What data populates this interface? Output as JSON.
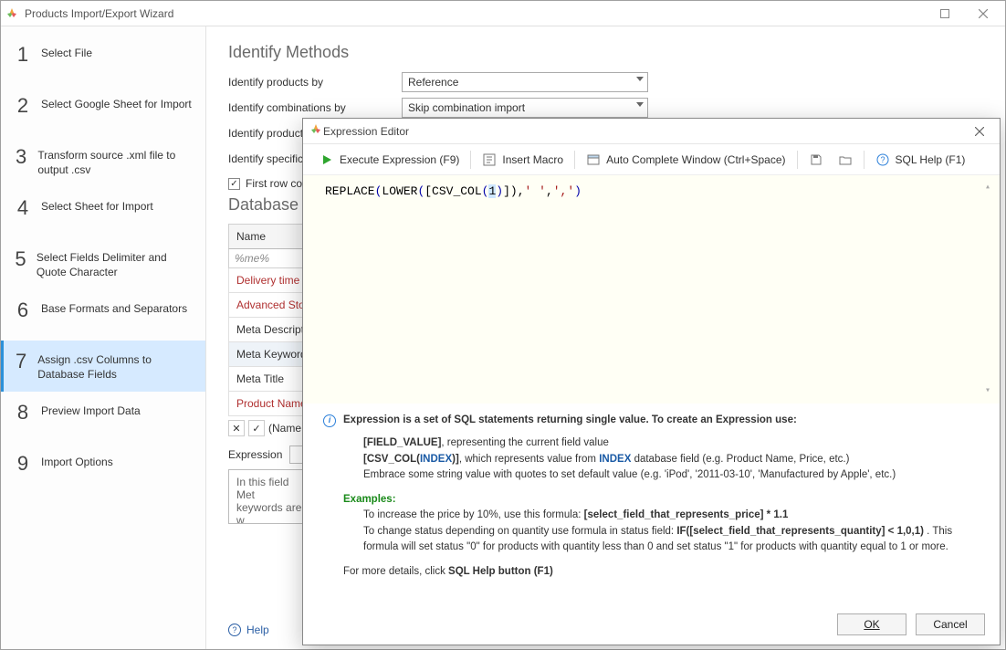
{
  "window": {
    "title": "Products Import/Export Wizard"
  },
  "steps": [
    {
      "num": "1",
      "label": "Select File"
    },
    {
      "num": "2",
      "label": "Select Google Sheet for Import"
    },
    {
      "num": "3",
      "label": "Transform source .xml file to output .csv"
    },
    {
      "num": "4",
      "label": "Select Sheet for Import"
    },
    {
      "num": "5",
      "label": "Select Fields Delimiter and Quote Character"
    },
    {
      "num": "6",
      "label": "Base Formats and Separators"
    },
    {
      "num": "7",
      "label": "Assign .csv Columns to Database Fields"
    },
    {
      "num": "8",
      "label": "Preview Import Data"
    },
    {
      "num": "9",
      "label": "Import Options"
    }
  ],
  "identify": {
    "section_title": "Identify Methods",
    "rows": {
      "products_by_label": "Identify products by",
      "products_by_value": "Reference",
      "combinations_by_label": "Identify combinations by",
      "combinations_by_value": "Skip combination import",
      "products_label_cut": "Identify product",
      "specific_label_cut": "Identify specific"
    },
    "first_row_label_cut": "First row con",
    "db_fields_title_cut": "Database F"
  },
  "table": {
    "header_name": "Name",
    "filter_text": "%me%",
    "rows": [
      {
        "text": "Delivery time",
        "red": true
      },
      {
        "text": "Advanced Stock",
        "red": true
      },
      {
        "text": "Meta Description",
        "red": false
      },
      {
        "text": "Meta Keywords",
        "red": false,
        "selected": true
      },
      {
        "text": "Meta Title",
        "red": false
      },
      {
        "text": "Product Name",
        "red": true
      }
    ],
    "name_cut": "(Name",
    "expression_label": "Expression",
    "desc_cut": "In this field Met keywords are w"
  },
  "help_label": "Help",
  "modal": {
    "title": "Expression Editor",
    "toolbar": {
      "execute": "Execute Expression (F9)",
      "insert_macro": "Insert Macro",
      "autocomplete": "Auto Complete Window (Ctrl+Space)",
      "sql_help": "SQL Help (F1)"
    },
    "expression_parts": {
      "p1": "REPLACE",
      "p2": "(",
      "p3": "LOWER",
      "p4": "(",
      "p5": "[CSV_COL",
      "p6": "(",
      "p7": "1",
      "p8": ")",
      "p9": "])",
      "p10": ",",
      "p11": "' '",
      "p12": ",",
      "p13": "','",
      "p14": ")"
    },
    "info": {
      "lead": "Expression is a set of SQL statements returning single value. To create an Expression use:",
      "fv_bold": "[FIELD_VALUE]",
      "fv_tail": ", representing the current field value",
      "csv_part1": "[CSV_COL(",
      "csv_index": "INDEX",
      "csv_part2": ")]",
      "csv_tail1": ", which represents value from ",
      "csv_tail2": " database field (e.g. Product Name, Price, etc.)",
      "embrace": "Embrace some string value with quotes to set default value (e.g. 'iPod', '2011-03-10', 'Manufactured by Apple', etc.)",
      "examples_label": "Examples:",
      "ex1_a": "To increase the price by 10%, use this formula: ",
      "ex1_b": "[select_field_that_represents_price] * 1.1",
      "ex2_a": "To change status depending on quantity use formula in status field: ",
      "ex2_b": "IF([select_field_that_represents_quantity] < 1,0,1)",
      "ex2_tail": " . This formula will set status \"0\" for products with quantity less than 0 and set status \"1\" for products with quantity equal to 1 or more.",
      "details_a": "For more details, click ",
      "details_b": "SQL Help button (F1)"
    },
    "buttons": {
      "ok": "OK",
      "cancel": "Cancel"
    }
  }
}
